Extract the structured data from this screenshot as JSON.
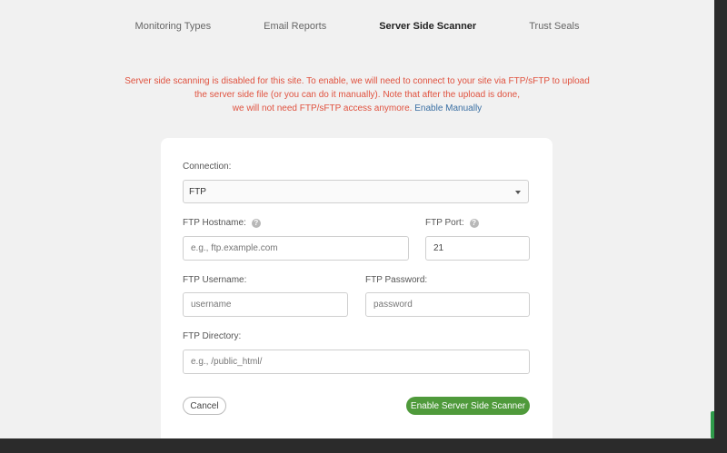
{
  "tabs": [
    {
      "label": "Monitoring Types",
      "active": false
    },
    {
      "label": "Email Reports",
      "active": false
    },
    {
      "label": "Server Side Scanner",
      "active": true
    },
    {
      "label": "Trust Seals",
      "active": false
    }
  ],
  "warning": {
    "line1": "Server side scanning is disabled for this site. To enable, we will need to connect to your site via FTP/sFTP to upload",
    "line2": "the server side file (or you can do it manually). Note that after the upload is done,",
    "line3": "we will not need FTP/sFTP access anymore.",
    "link": "Enable Manually"
  },
  "form": {
    "connection_label": "Connection:",
    "connection_value": "FTP",
    "hostname_label": "FTP Hostname:",
    "hostname_placeholder": "e.g., ftp.example.com",
    "port_label": "FTP Port:",
    "port_value": "21",
    "username_label": "FTP Username:",
    "username_placeholder": "username",
    "password_label": "FTP Password:",
    "password_placeholder": "password",
    "directory_label": "FTP Directory:",
    "directory_placeholder": "e.g., /public_html/",
    "help_glyph": "?"
  },
  "buttons": {
    "cancel": "Cancel",
    "enable": "Enable Server Side Scanner"
  },
  "colors": {
    "warning": "#e0523f",
    "link": "#3a6fa3",
    "primary_button": "#4f9a3b"
  }
}
